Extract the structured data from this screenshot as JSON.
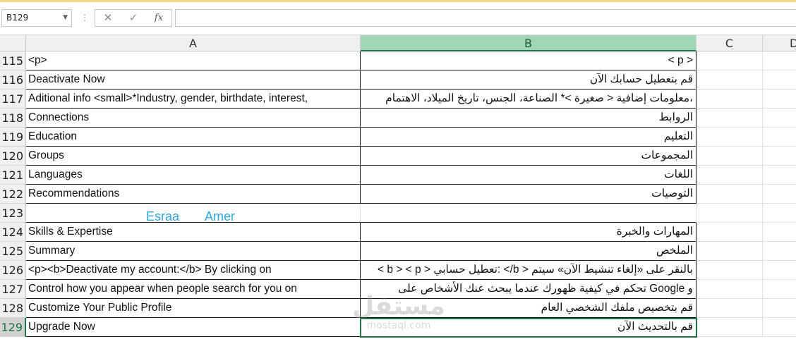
{
  "name_box": {
    "value": "B129"
  },
  "formula_bar": {
    "fx_label": "fx",
    "cancel_glyph": "✕",
    "enter_glyph": "✓",
    "dots": "⋮",
    "value": ""
  },
  "columns": [
    {
      "label": "A",
      "selected": false
    },
    {
      "label": "B",
      "selected": true
    },
    {
      "label": "C",
      "selected": false
    },
    {
      "label": "D",
      "selected": false
    }
  ],
  "rows": [
    {
      "num": "115",
      "a": "<p>",
      "b": "< p >"
    },
    {
      "num": "116",
      "a": "Deactivate Now",
      "b": "قم بتعطيل حسابك الآن"
    },
    {
      "num": "117",
      "a": "Aditional info <small>*Industry, gender, birthdate, interest,",
      "b": "،معلومات إضافية < صغيرة >* الصناعة، الجنس، تاريخ الميلاد، الاهتمام"
    },
    {
      "num": "118",
      "a": "Connections",
      "b": "الروابط"
    },
    {
      "num": "119",
      "a": "Education",
      "b": "التعليم"
    },
    {
      "num": "120",
      "a": "Groups",
      "b": "المجموعات"
    },
    {
      "num": "121",
      "a": "Languages",
      "b": "اللغات"
    },
    {
      "num": "122",
      "a": "Recommendations",
      "b": "التوصيات"
    },
    {
      "num": "123",
      "a": "",
      "b": ""
    },
    {
      "num": "124",
      "a": "Skills & Expertise",
      "b": "المهارات والخبرة"
    },
    {
      "num": "125",
      "a": "Summary",
      "b": "الملخص"
    },
    {
      "num": "126",
      "a": "<p><b>Deactivate my account:</b> By clicking on",
      "b": "بالنقر على «إلغاء تنشيط الآن» سيتم < b/> :تعطيل حسابي < b > < p >"
    },
    {
      "num": "127",
      "a": "Control how you appear when people search for you on",
      "b": "و Google تحكم في كيفية ظهورك عندما يبحث عنك الأشخاص على"
    },
    {
      "num": "128",
      "a": "Customize Your Public Profile",
      "b": "قم بتخصيص ملفك الشخصي العام"
    },
    {
      "num": "129",
      "a": "Upgrade Now",
      "b": "قم بالتحديث الآن"
    }
  ],
  "overlay_text": {
    "first": "Esraa",
    "second": "Amer"
  },
  "watermark": {
    "arabic": "مستقل",
    "latin": "mostaql.com"
  },
  "colors": {
    "accent": "#217346",
    "selected_header": "#a0d6b4",
    "overlay_text": "#2ea6dc"
  }
}
